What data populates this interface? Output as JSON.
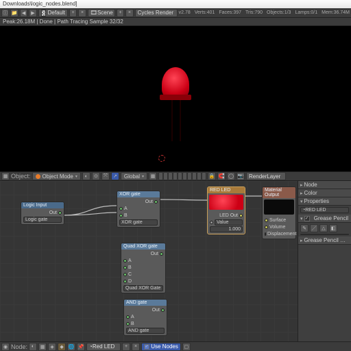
{
  "titlebar": "Downloads\\logic_nodes.blend]",
  "topmenu": {
    "layout_label": "Default",
    "scene_label": "Scene",
    "engine": "Cycles Render",
    "version": "v2.78",
    "stats": [
      "Verts:401",
      "Faces:397",
      "Tris:790",
      "Objects:1/3",
      "Lamps:0/1",
      "Mem:36.74M"
    ]
  },
  "statusline": "Peak:26.18M | Done | Path Tracing Sample 32/32",
  "header3d": {
    "label_object": "Object:",
    "mode": "Object Mode",
    "orient": "Global",
    "layer": "RenderLayer"
  },
  "nodes": {
    "input": {
      "title": "Logic Input",
      "socket_out": "Out",
      "field": "Logic gate"
    },
    "xor": {
      "title": "XOR gate",
      "out": "Out",
      "inA": "A",
      "inB": "B",
      "field": "XOR gate"
    },
    "quadxor": {
      "title": "Quad XOR gate",
      "out": "Out",
      "inA": "A",
      "inB": "B",
      "inC": "C",
      "inD": "D",
      "field": "Quad XOR Gate"
    },
    "and": {
      "title": "AND gate",
      "out": "Out",
      "inA": "A",
      "inB": "B",
      "field": "AND gate"
    },
    "redled": {
      "title": "RED LED",
      "out": "LED Out",
      "field": "Value",
      "val": "1.000"
    },
    "output": {
      "title": "Material Output",
      "s1": "Surface",
      "s2": "Volume",
      "s3": "Displacement"
    }
  },
  "sidebar": {
    "node": "Node",
    "color": "Color",
    "properties": "Properties",
    "prop_field": "RED LED",
    "gp": "Grease Pencil",
    "gp_colors": "Grease Pencil …"
  },
  "nodefooter": {
    "label_node": "Node:",
    "matname": "Red LED",
    "usenodes": "Use Nodes"
  }
}
